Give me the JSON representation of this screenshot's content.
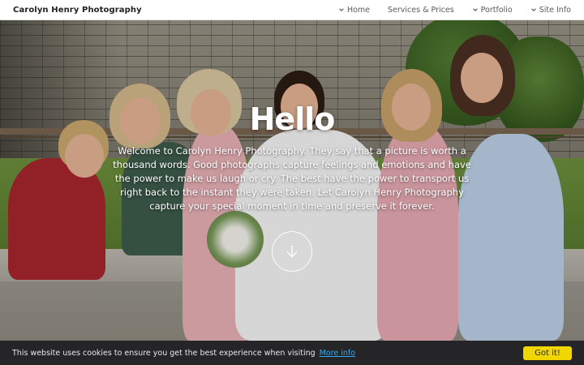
{
  "site": {
    "brand": "Carolyn Henry Photography"
  },
  "nav": {
    "items": [
      {
        "label": "Home",
        "icon": "chevron-down-icon"
      },
      {
        "label": "Services & Prices",
        "icon": null
      },
      {
        "label": "Portfolio",
        "icon": "chevron-down-icon"
      },
      {
        "label": "Site Info",
        "icon": "chevron-down-icon"
      }
    ]
  },
  "hero": {
    "title": "Hello",
    "body": "Welcome to Carolyn Henry Photography. They say that a picture is worth a thousand words. Good photographs capture feelings and emotions and have the power to make us laugh or cry. The best have the power to transport us right back to the instant they were taken. Let Carolyn Henry Photography capture your special moment in time and preserve it forever.",
    "scroll_icon": "arrow-down-icon"
  },
  "cookie": {
    "message": "This website uses cookies to ensure you get the best experience when visiting",
    "link": "More info",
    "button": "Got it!"
  },
  "colors": {
    "accent_button": "#f1d600",
    "link": "#31a8f0",
    "cookie_bg": "#252527"
  }
}
